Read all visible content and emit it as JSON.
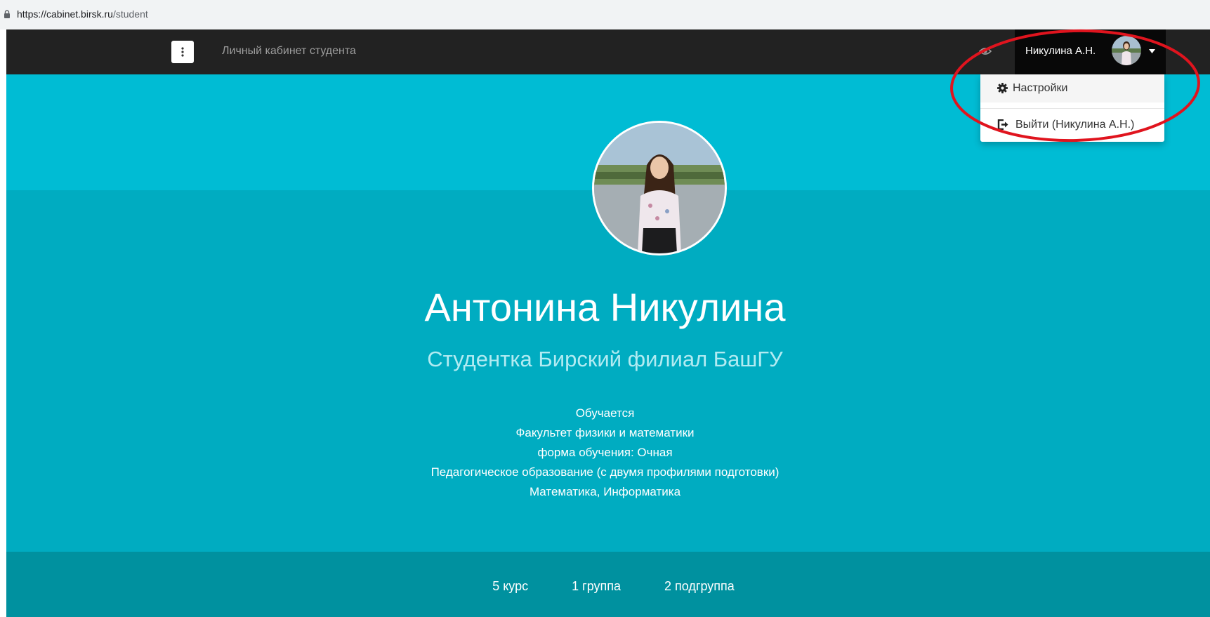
{
  "browser": {
    "url_host": "https://cabinet.birsk.ru",
    "url_path": "/student"
  },
  "navbar": {
    "brand": "Личный кабинет студента",
    "user_name": "Никулина А.Н."
  },
  "dropdown": {
    "settings_label": "Настройки",
    "logout_label": "Выйти (Никулина А.Н.)"
  },
  "profile": {
    "full_name": "Антонина Никулина",
    "subtitle": "Студентка Бирский филиал БашГУ",
    "details": [
      "Обучается",
      "Факультет физики и математики",
      "форма обучения: Очная",
      "Педагогическое образование (с двумя профилями подготовки)",
      "Математика, Информатика"
    ]
  },
  "stats": {
    "course": "5 курс",
    "group": "1 группа",
    "subgroup": "2 подгруппа"
  },
  "colors": {
    "navbar": "#222222",
    "hero_top": "#00bcd4",
    "hero_main": "#00acc1",
    "hero_footer": "#00919f",
    "annotation": "#e0141e"
  },
  "icons": [
    "lock-icon",
    "menu-dots-icon",
    "eye-icon",
    "caret-down-icon",
    "gear-icon",
    "logout-icon"
  ]
}
